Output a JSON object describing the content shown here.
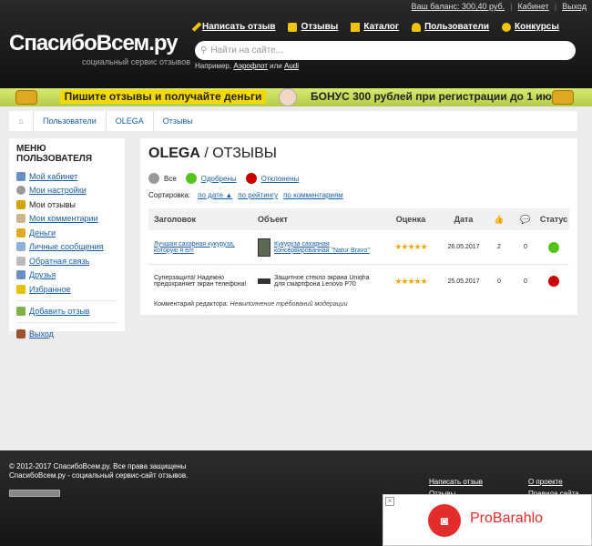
{
  "topbar": {
    "balance_label": "Ваш баланс: 300,40 руб.",
    "cabinet": "Кабинет",
    "exit": "Выход"
  },
  "logo": {
    "text": "СпасибоВсем.ру",
    "subtitle": "социальный сервис отзывов"
  },
  "nav": [
    {
      "label": "Написать отзыв",
      "icon": "pencil-icon",
      "color": "#f2c400"
    },
    {
      "label": "Отзывы",
      "icon": "speech-bubble-icon",
      "color": "#f2c400"
    },
    {
      "label": "Каталог",
      "icon": "folder-icon",
      "color": "#f2c400"
    },
    {
      "label": "Пользователи",
      "icon": "user-icon",
      "color": "#f2c400"
    },
    {
      "label": "Конкурсы",
      "icon": "bulb-icon",
      "color": "#f2c400"
    }
  ],
  "search": {
    "placeholder": "Найти на сайте...",
    "example_prefix": "Например,",
    "example_1": "Аэрофлот",
    "example_or": "или",
    "example_2": "Audi"
  },
  "promo": {
    "left_text": "Пишите отзывы и получайте деньги",
    "right_text": "БОНУС 300 рублей при регистрации до 1 июня!"
  },
  "breadcrumbs": [
    "Пользователи",
    "OLEGA",
    "Отзывы"
  ],
  "sidebar": {
    "title": "МЕНЮ ПОЛЬЗОВАТЕЛЯ",
    "items": [
      {
        "label": "Мой кабинет",
        "icon": "user-icon",
        "current": false
      },
      {
        "label": "Мои настройки",
        "icon": "gear-icon",
        "current": false
      },
      {
        "label": "Мои отзывы",
        "icon": "pencil-icon",
        "current": true
      },
      {
        "label": "Мои комментарии",
        "icon": "comment-icon",
        "current": false
      },
      {
        "label": "Деньги",
        "icon": "money-icon",
        "current": false
      },
      {
        "label": "Личные сообщения",
        "icon": "chat-icon",
        "current": false
      },
      {
        "label": "Обратная связь",
        "icon": "mail-icon",
        "current": false
      },
      {
        "label": "Друзья",
        "icon": "friends-icon",
        "current": false
      },
      {
        "label": "Избранное",
        "icon": "star-icon",
        "current": false
      }
    ],
    "add_review": "Добавить отзыв",
    "logout": "Выход"
  },
  "main": {
    "user": "OLEGA",
    "section": " / ОТЗЫВЫ",
    "filters": [
      {
        "label": "Все",
        "color": "#999999"
      },
      {
        "label": "Одобрены",
        "color": "#52c41a"
      },
      {
        "label": "Отклонены",
        "color": "#cc0000"
      }
    ],
    "sort_label": "Сортировка:",
    "sort_options": [
      "по дате ▲",
      "по рейтингу",
      "по комментариям"
    ],
    "columns": [
      "Заголовок",
      "Объект",
      "Оценка",
      "Дата",
      "👍",
      "💬",
      "Статус"
    ],
    "rows": [
      {
        "title": "Лучшая сахарная кукуруза, которую я ел!",
        "object": "Кукуруза сахарная консервированная \"Natur Bravo\"",
        "rating": "★★★★★",
        "date": "26.05.2017",
        "likes": "2",
        "comments": "0",
        "status_color": "#52c41a"
      },
      {
        "title": "Суперзащита! Надежно предохраняет экран телефона!",
        "object": "Защитное стекло экрана Uniqha для смартфона Lenovo P70",
        "rating": "★★★★★",
        "date": "25.05.2017",
        "likes": "0",
        "comments": "0",
        "status_color": "#cc0000"
      }
    ],
    "editor_note_label": "Комментарий редактора:",
    "editor_note": "Невыполнение требований модерации"
  },
  "footer": {
    "copyright": "© 2012-2017 СпасибоВсем.ру. Все права защищены",
    "tagline": "СпасибоВсем.ру - социальный сервис-сайт отзывов.",
    "links_col1": [
      "Написать отзыв",
      "Отзывы"
    ],
    "links_col2": [
      "О проекте",
      "Правила сайта"
    ]
  },
  "ad": {
    "text": "ProBarahlo",
    "close": "×"
  }
}
